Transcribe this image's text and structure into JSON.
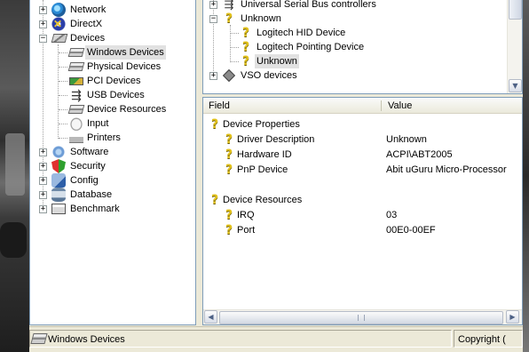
{
  "left_tree": {
    "items": [
      {
        "label": "Network",
        "icon": "network-icon"
      },
      {
        "label": "DirectX",
        "icon": "directx-icon"
      },
      {
        "label": "Devices",
        "icon": "devices-icon"
      },
      {
        "label": "Windows Devices",
        "icon": "windows-devices-icon",
        "selected": true
      },
      {
        "label": "Physical Devices",
        "icon": "physical-devices-icon"
      },
      {
        "label": "PCI Devices",
        "icon": "pci-devices-icon"
      },
      {
        "label": "USB Devices",
        "icon": "usb-devices-icon"
      },
      {
        "label": "Device Resources",
        "icon": "device-resources-icon"
      },
      {
        "label": "Input",
        "icon": "mouse-icon"
      },
      {
        "label": "Printers",
        "icon": "printer-icon"
      },
      {
        "label": "Software",
        "icon": "software-icon"
      },
      {
        "label": "Security",
        "icon": "security-shield-icon"
      },
      {
        "label": "Config",
        "icon": "config-icon"
      },
      {
        "label": "Database",
        "icon": "database-icon"
      },
      {
        "label": "Benchmark",
        "icon": "benchmark-icon"
      }
    ]
  },
  "device_tree": {
    "items": [
      {
        "label": "Universal Serial Bus controllers",
        "icon": "usb-controller-icon"
      },
      {
        "label": "Unknown",
        "icon": "question-mark-icon"
      },
      {
        "label": "Logitech HID Device",
        "icon": "question-mark-icon"
      },
      {
        "label": "Logitech Pointing Device",
        "icon": "question-mark-icon"
      },
      {
        "label": "Unknown",
        "icon": "question-mark-icon",
        "selected": true
      },
      {
        "label": "VSO devices",
        "icon": "diamond-device-icon"
      }
    ]
  },
  "details": {
    "columns": {
      "field": "Field",
      "value": "Value"
    },
    "groups": [
      {
        "title": "Device Properties",
        "rows": [
          {
            "field": "Driver Description",
            "value": "Unknown"
          },
          {
            "field": "Hardware ID",
            "value": "ACPI\\ABT2005"
          },
          {
            "field": "PnP Device",
            "value": "Abit uGuru Micro-Processor"
          }
        ]
      },
      {
        "title": "Device Resources",
        "rows": [
          {
            "field": "IRQ",
            "value": "03"
          },
          {
            "field": "Port",
            "value": "00E0-00EF"
          }
        ]
      }
    ]
  },
  "statusbar": {
    "left": "Windows Devices",
    "right": "Copyright ("
  },
  "colors": {
    "window_bg": "#ece9d8",
    "panel_border": "#7f9db9",
    "selection_bg": "#e1e1e1",
    "question_icon": "#e2c21c"
  }
}
